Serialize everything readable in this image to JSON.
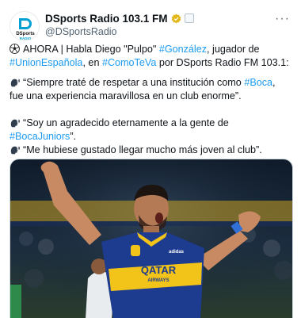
{
  "author": {
    "display_name": "DSports Radio 103.1 FM",
    "handle": "@DSportsRadio",
    "avatar_text_top": "DSports",
    "avatar_text_bottom": "RADIO",
    "verified_badge_color": "#e2b719"
  },
  "tweet": {
    "p1": {
      "prefix": "AHORA | Habla Diego \"Pulpo\" ",
      "tag1": "#González",
      "mid": ", jugador de",
      "tag2": "#UnionEspañola",
      "sep": ", en ",
      "tag3": "#ComoTeVa",
      "suffix": " por DSports Radio FM 103.1:"
    },
    "p2": {
      "prefix": "“Siempre traté de respetar a una institución como ",
      "tag": "#Boca",
      "suffix": ", fue una experiencia maravillosa en un club enorme”."
    },
    "p3": {
      "prefix": "“Soy un agradecido eternamente a la gente de ",
      "tag": "#BocaJuniors",
      "suffix": "”."
    },
    "p4": {
      "text": "“Me hubiese gustado llegar mucho más joven al club”."
    },
    "icons": {
      "p1": "soccer-ball-icon",
      "p2": "speaking-head-icon",
      "p3": "speaking-head-icon",
      "p4": "speaking-head-icon"
    }
  },
  "media": {
    "jersey_sponsor_top": "QATAR",
    "jersey_sponsor_bottom": "AIRWAYS",
    "colors": {
      "jersey_blue": "#1d3b8f",
      "jersey_gold": "#f2c419",
      "stadium": "#1a2a3e"
    }
  },
  "colors": {
    "link": "#1d9bf0",
    "text": "#0f1419",
    "secondary": "#536471"
  }
}
